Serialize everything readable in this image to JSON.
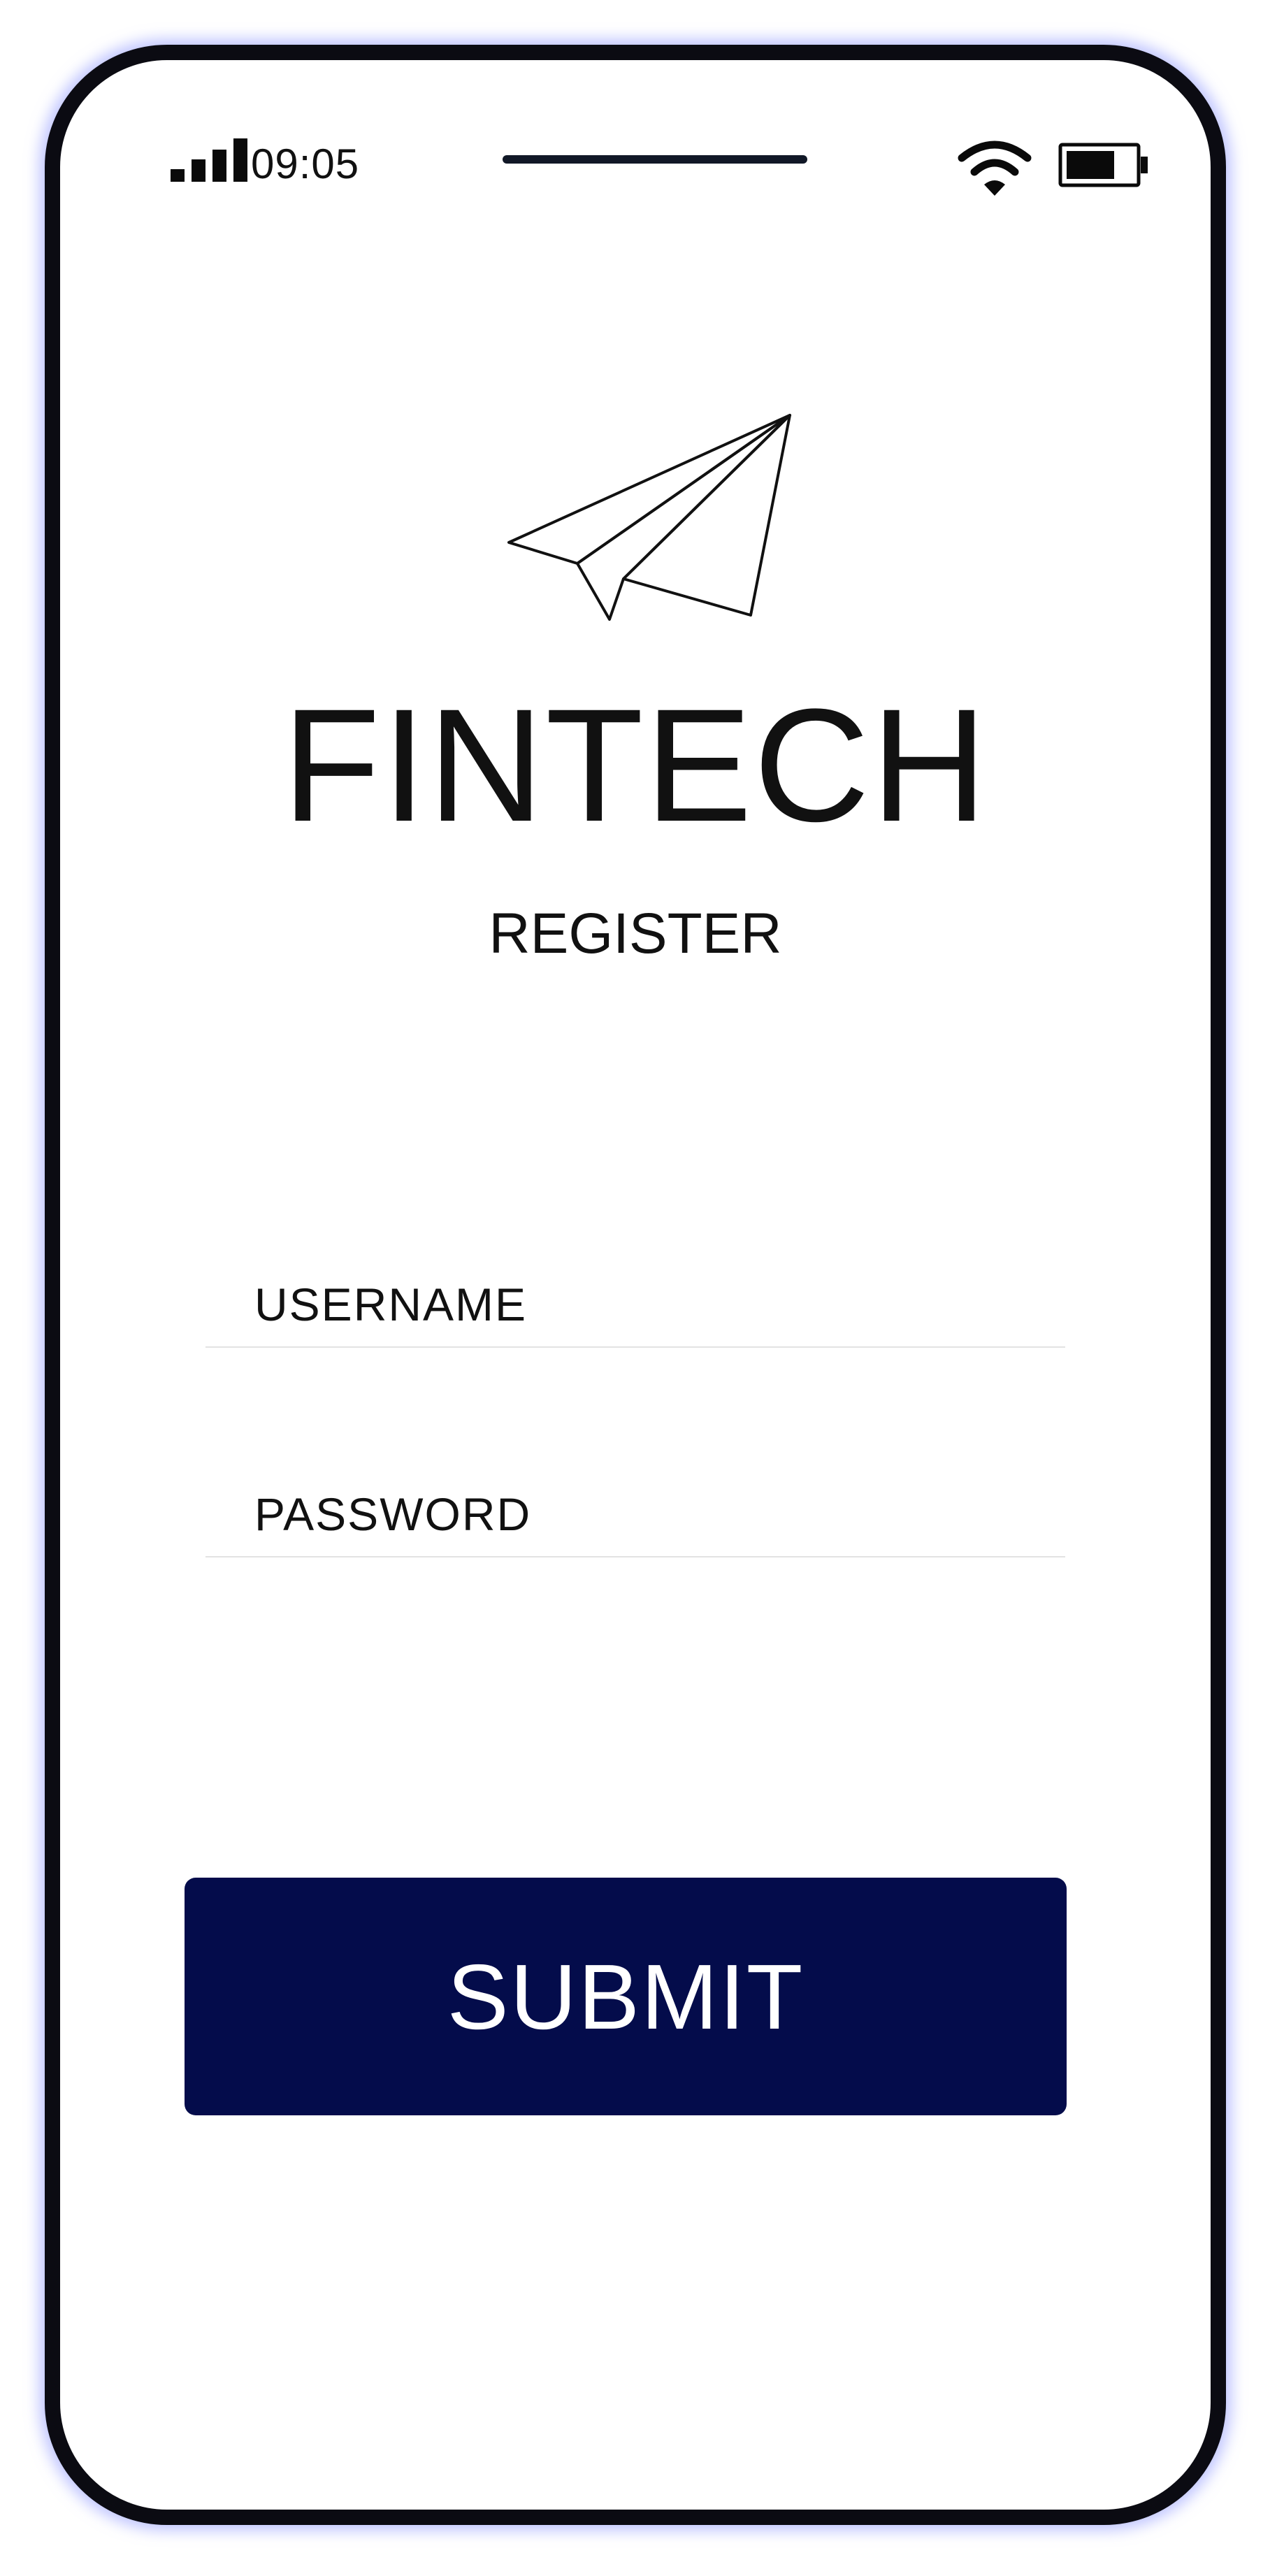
{
  "status_bar": {
    "time": "09:05",
    "icons": [
      "signal-icon",
      "wifi-icon",
      "battery-icon"
    ],
    "battery_level": 0.72
  },
  "app": {
    "logo_icon": "paper-plane-icon",
    "title": "FINTECH",
    "subtitle": "REGISTER"
  },
  "form": {
    "username": {
      "placeholder": "USERNAME",
      "value": ""
    },
    "password": {
      "placeholder": "PASSWORD",
      "value": ""
    },
    "submit_label": "SUBMIT"
  },
  "colors": {
    "primary": "#040c4b",
    "frame": "#0b0b12",
    "glow": "#8c96ff",
    "text": "#111111",
    "divider": "#e3e3e3",
    "background": "#ffffff"
  }
}
